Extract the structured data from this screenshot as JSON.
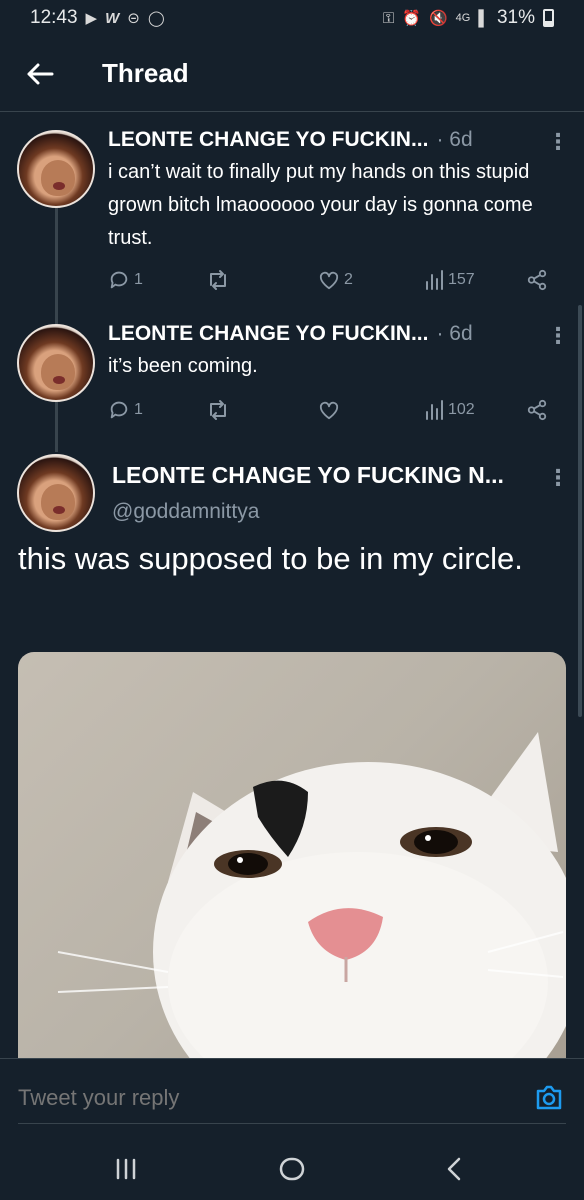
{
  "status_bar": {
    "time": "12:43",
    "left_icons": [
      "play-icon",
      "w-icon",
      "minus-circle-icon",
      "shield-icon"
    ],
    "right_icons": [
      "vpn-key-icon",
      "alarm-icon",
      "mute-icon",
      "data-4g-icon",
      "signal-icon"
    ],
    "battery": "31%",
    "battery_level": 0.31
  },
  "header": {
    "title": "Thread"
  },
  "thread": [
    {
      "name": "LEONTE CHANGE YO FUCKIN...",
      "meta": "· 6d",
      "text": "i can’t wait to finally put my hands on this stupid grown bitch lmaoooooo your day is gonna come trust.",
      "replies": "1",
      "retweets": "",
      "likes": "2",
      "views": "157"
    },
    {
      "name": "LEONTE CHANGE YO FUCKIN...",
      "meta": "· 6d",
      "text": "it’s been coming.",
      "replies": "1",
      "retweets": "",
      "likes": "",
      "views": "102"
    }
  ],
  "main_tweet": {
    "name": "LEONTE CHANGE YO FUCKING N...",
    "handle": "@goddamnittya",
    "text": "this was supposed to be in my circle."
  },
  "reply": {
    "placeholder": "Tweet your reply"
  },
  "colors": {
    "background": "#15202b",
    "text": "#ffffff",
    "muted": "#8b98a5",
    "accent": "#1d9bf0",
    "divider": "#38444d"
  }
}
